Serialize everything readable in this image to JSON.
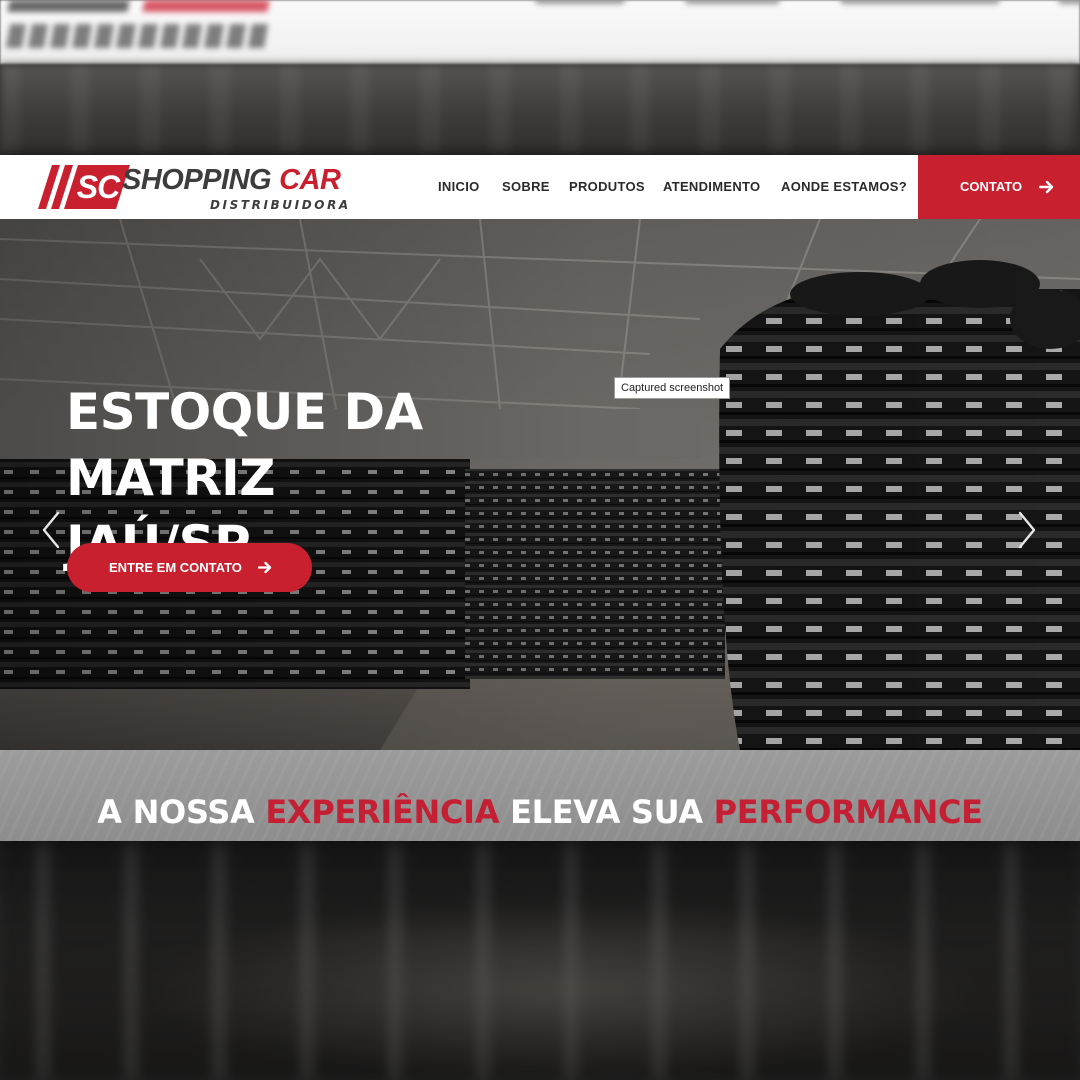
{
  "brand": {
    "mark": "SC",
    "name_part1": "SHOPPING",
    "name_part2": "CAR",
    "subtitle": "DISTRIBUIDORA"
  },
  "nav": {
    "items": [
      "INICIO",
      "SOBRE",
      "PRODUTOS",
      "ATENDIMENTO",
      "AONDE ESTAMOS?"
    ],
    "cta_label": "CONTATO"
  },
  "hero": {
    "title_line1": "ESTOQUE DA MATRIZ",
    "title_line2": "JAÚ/SP",
    "button_label": "ENTRE EM CONTATO"
  },
  "tooltip": "Captured screenshot",
  "tagline": {
    "part1": "A NOSSA",
    "part2": "EXPERIÊNCIA",
    "part3": "ELEVA SUA",
    "part4": "PERFORMANCE"
  },
  "icons": {
    "cta_arrow": "arrow-right-icon",
    "carousel_prev": "chevron-left-icon",
    "carousel_next": "chevron-right-icon"
  },
  "colors": {
    "brand_red": "#c9202f",
    "brand_dark": "#3d3d3d",
    "header_bg": "#ffffff",
    "band_bg": "#959595"
  }
}
